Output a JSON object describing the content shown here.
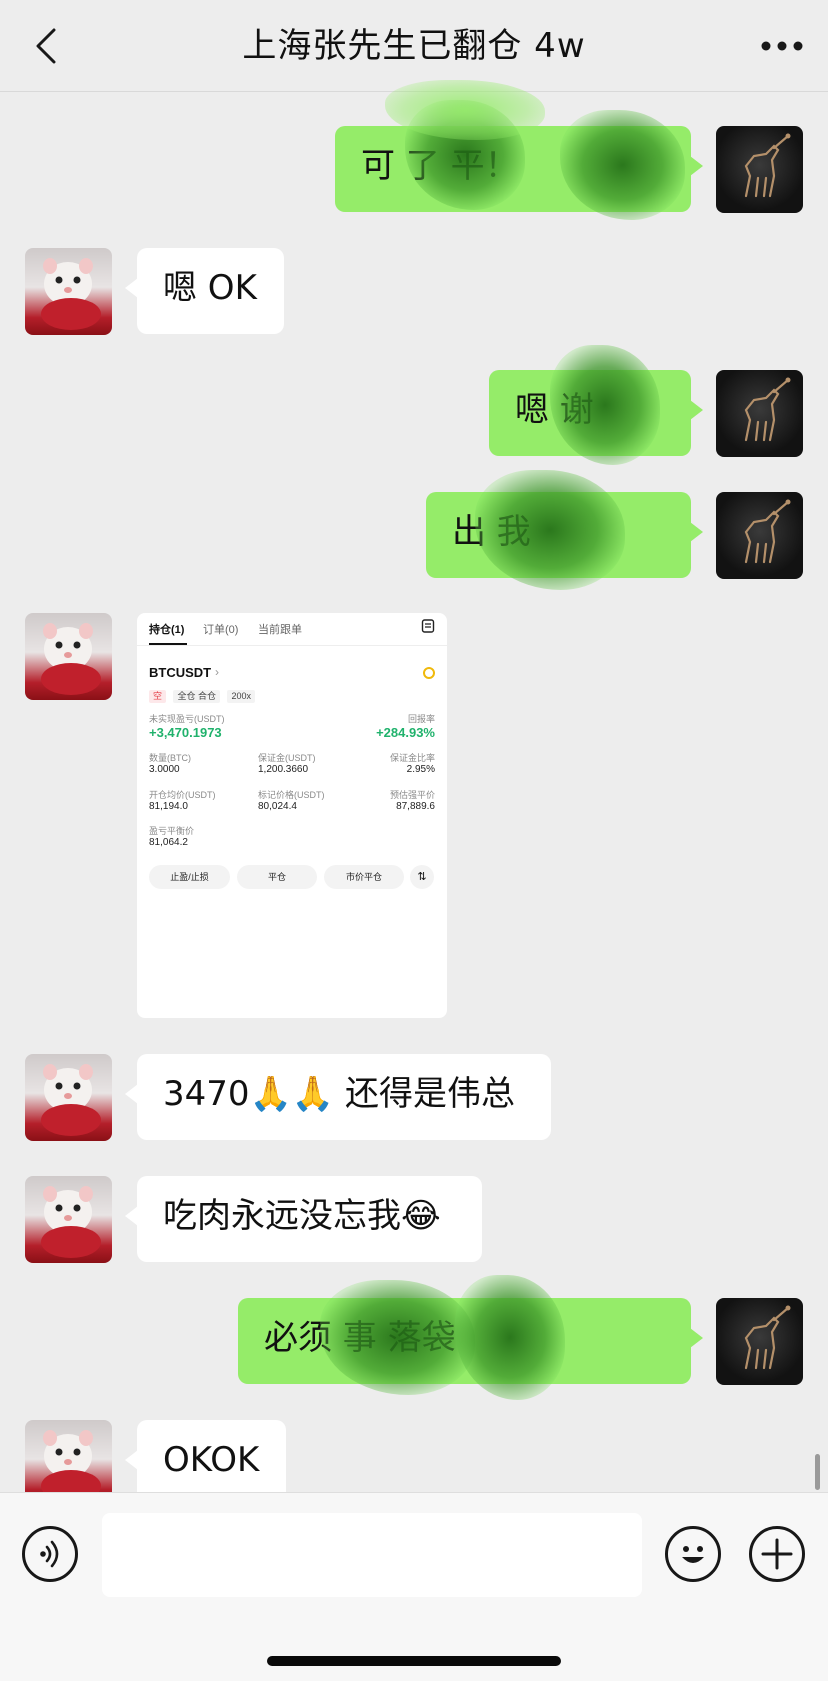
{
  "header": {
    "title": "上海张先生已翻仓 4w",
    "back_icon": "chevron-left-icon",
    "more_icon": "more-dots-icon"
  },
  "messages": [
    {
      "from": "me",
      "text": "可    了 平！"
    },
    {
      "from": "them",
      "text": "嗯 OK"
    },
    {
      "from": "me",
      "text": "嗯 谢"
    },
    {
      "from": "me",
      "text": "出              我"
    },
    {
      "from": "them",
      "type": "image"
    },
    {
      "from": "them",
      "text": "3470🙏🙏 还得是伟总"
    },
    {
      "from": "them",
      "text": "吃肉永远没忘我😂"
    },
    {
      "from": "me",
      "text": "必须                     事 落袋"
    },
    {
      "from": "them",
      "text": "OKOK"
    }
  ],
  "screenshot": {
    "tabs": [
      "持仓(1)",
      "订单(0)",
      "当前跟单"
    ],
    "symbol": "BTCUSDT",
    "tags": [
      "空",
      "全仓 合仓",
      "200x"
    ],
    "unrealized_pnl_label": "未实现盈亏(USDT)",
    "unrealized_pnl": "+3,470.1973",
    "roe_label": "回报率",
    "roe": "+284.93%",
    "size_label": "数量(BTC)",
    "size": "3.0000",
    "margin_label": "保证金(USDT)",
    "margin": "1,200.3660",
    "margin_ratio_label": "保证金比率",
    "margin_ratio": "2.95%",
    "entry_label": "开仓均价(USDT)",
    "entry": "81,194.0",
    "mark_label": "标记价格(USDT)",
    "mark": "80,024.4",
    "liq_label": "预估强平价",
    "liq": "87,889.6",
    "breakeven_label": "盈亏平衡价",
    "breakeven": "81,064.2",
    "buttons": [
      "止盈/止损",
      "平仓",
      "市价平仓"
    ],
    "accent_green": "#20b26c",
    "accent_red": "#e5404a"
  },
  "input_bar": {
    "voice_icon": "voice-icon",
    "emoji_icon": "emoji-icon",
    "plus_icon": "plus-icon",
    "input_value": ""
  },
  "colors": {
    "my_bubble": "#95ec69",
    "their_bubble": "#ffffff",
    "background": "#ededed"
  }
}
